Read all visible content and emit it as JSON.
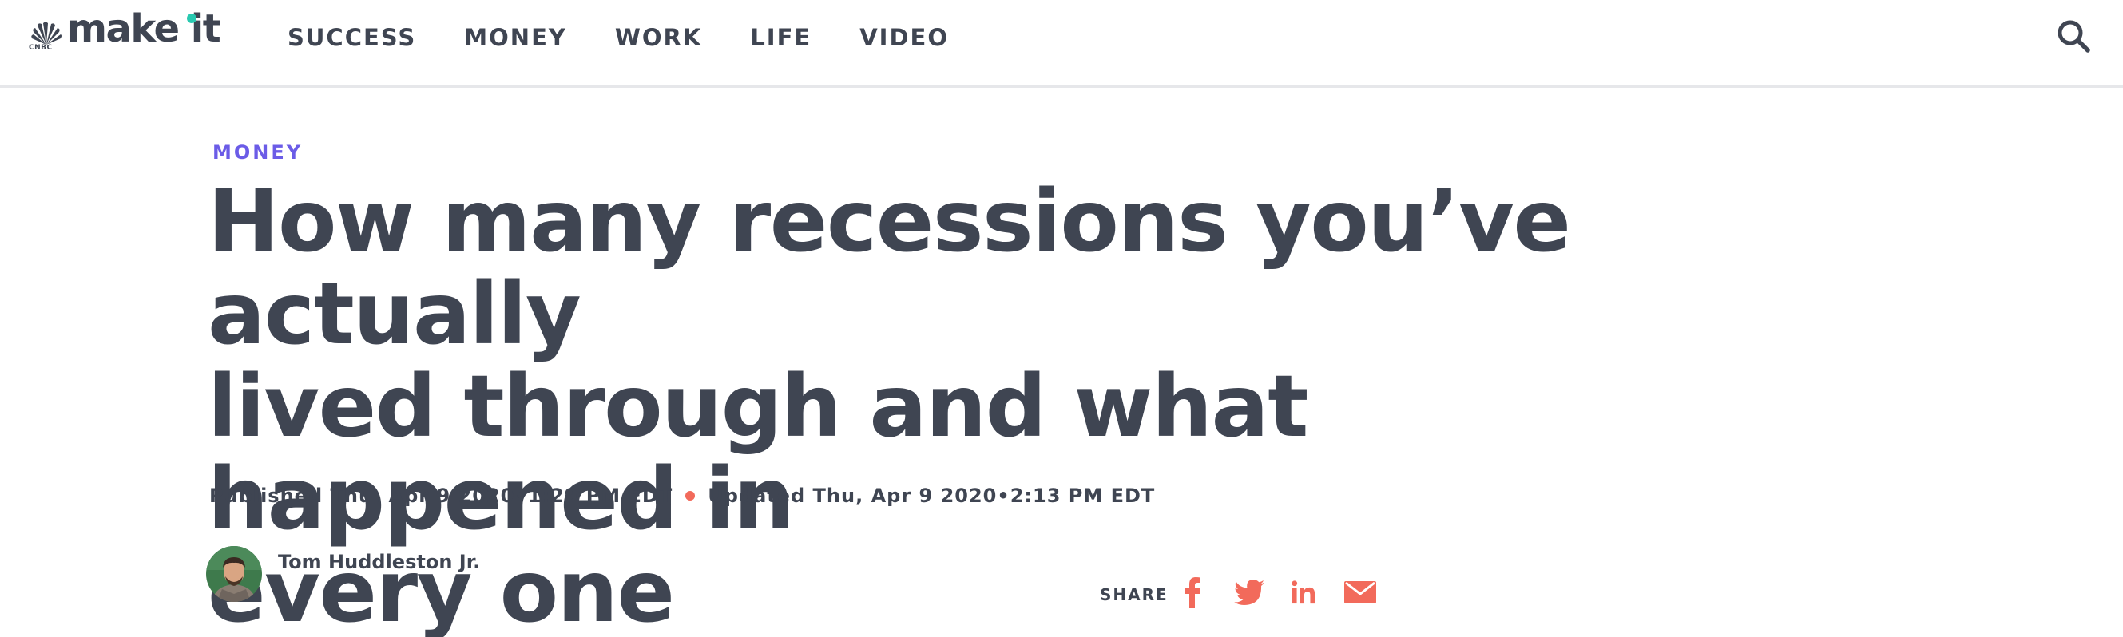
{
  "brand": {
    "logo_text": "make it",
    "parent_tag": "CNBC",
    "accent_color": "#29c9b0"
  },
  "nav": {
    "items": [
      "SUCCESS",
      "MONEY",
      "WORK",
      "LIFE",
      "VIDEO"
    ]
  },
  "search": {
    "icon": "search-icon"
  },
  "article": {
    "section": "MONEY",
    "section_color": "#6b5ce7",
    "headline_lines": [
      "How many recessions you’ve actually",
      "lived through and what happened in",
      "every one"
    ],
    "published": "Published Thu, Apr 9 2020•1:29 PM EDT",
    "updated": "Updated Thu, Apr 9 2020•2:13 PM EDT",
    "dot_color": "#f26a5b",
    "author": "Tom Huddleston Jr."
  },
  "share": {
    "label": "SHARE",
    "icon_color": "#f26a5b",
    "icons": [
      "facebook-icon",
      "twitter-icon",
      "linkedin-icon",
      "email-icon"
    ]
  }
}
